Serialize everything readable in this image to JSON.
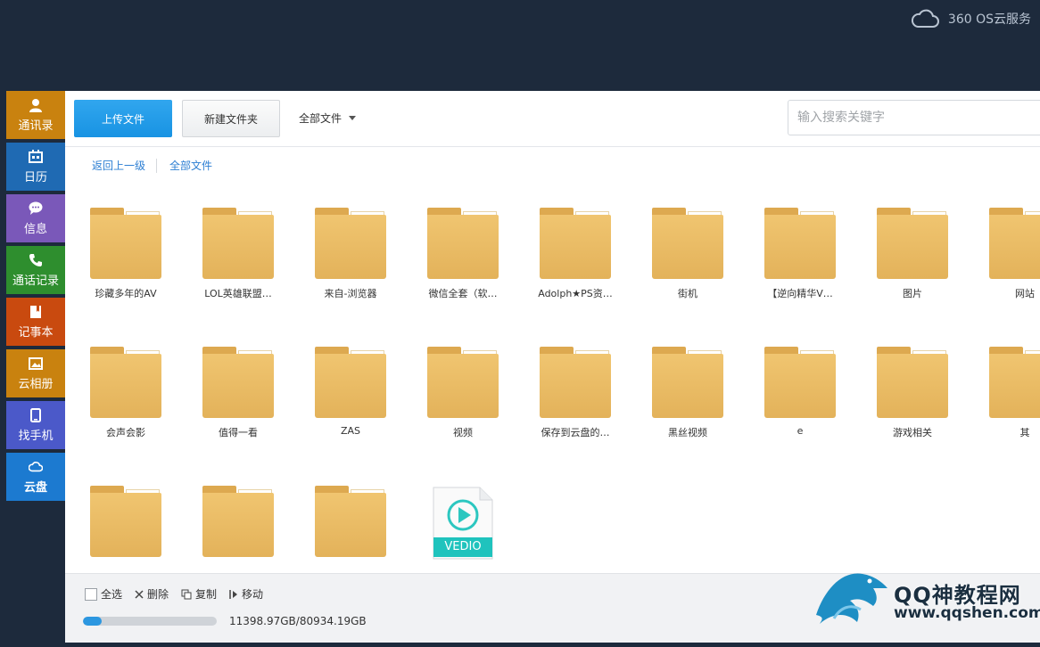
{
  "header": {
    "service_label": "360 OS云服务",
    "icon": "cloud-icon"
  },
  "sidebar": {
    "items": [
      {
        "label": "通讯录",
        "icon": "person-icon",
        "color": "#c9820f"
      },
      {
        "label": "日历",
        "icon": "calendar-icon",
        "color": "#1f6ab3"
      },
      {
        "label": "信息",
        "icon": "chat-icon",
        "color": "#7a58b9"
      },
      {
        "label": "通话记录",
        "icon": "phone-icon",
        "color": "#2e8e2e"
      },
      {
        "label": "记事本",
        "icon": "notebook-icon",
        "color": "#c94a0f"
      },
      {
        "label": "云相册",
        "icon": "image-icon",
        "color": "#c9820f"
      },
      {
        "label": "找手机",
        "icon": "phone-device-icon",
        "color": "#4b59c9"
      },
      {
        "label": "云盘",
        "icon": "cloud-icon",
        "color": "#1c7ad0"
      }
    ]
  },
  "toolbar": {
    "upload_label": "上传文件",
    "new_folder_label": "新建文件夹",
    "filter_label": "全部文件",
    "search_placeholder": "输入搜索关键字"
  },
  "breadcrumb": {
    "back": "返回上一级",
    "current": "全部文件"
  },
  "files": [
    {
      "name": "珍藏多年的AV",
      "type": "folder"
    },
    {
      "name": "LOL英雄联盟…",
      "type": "folder"
    },
    {
      "name": "来自-浏览器",
      "type": "folder"
    },
    {
      "name": "微信全套（软…",
      "type": "folder"
    },
    {
      "name": "Adolph★PS资…",
      "type": "folder"
    },
    {
      "name": "街机",
      "type": "folder"
    },
    {
      "name": "【逆向精华V…",
      "type": "folder"
    },
    {
      "name": "图片",
      "type": "folder"
    },
    {
      "name": "网站",
      "type": "folder"
    },
    {
      "name": "会声会影",
      "type": "folder"
    },
    {
      "name": "值得一看",
      "type": "folder"
    },
    {
      "name": "ZAS",
      "type": "folder"
    },
    {
      "name": "视频",
      "type": "folder"
    },
    {
      "name": "保存到云盘的…",
      "type": "folder"
    },
    {
      "name": "黑丝视频",
      "type": "folder"
    },
    {
      "name": "e",
      "type": "folder"
    },
    {
      "name": "游戏相关",
      "type": "folder"
    },
    {
      "name": "其",
      "type": "folder"
    },
    {
      "name": "",
      "type": "folder"
    },
    {
      "name": "",
      "type": "folder"
    },
    {
      "name": "",
      "type": "folder"
    },
    {
      "name": "",
      "type": "video",
      "badge": "VEDIO"
    }
  ],
  "footer": {
    "select_all": "全选",
    "delete": "删除",
    "copy": "复制",
    "move": "移动",
    "quota_text": "11398.97GB/80934.19GB",
    "quota_fraction": 0.14
  },
  "watermark": {
    "title": "QQ神教程网",
    "url": "www.qqshen.com"
  }
}
